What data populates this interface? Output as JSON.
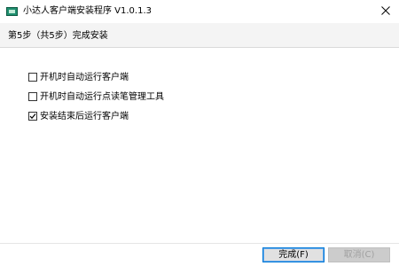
{
  "window": {
    "title": "小达人客户端安装程序 V1.0.1.3"
  },
  "step": {
    "title": "第5步（共5步）完成安装"
  },
  "options": [
    {
      "label": "开机时自动运行客户端",
      "checked": false
    },
    {
      "label": "开机时自动运行点读笔管理工具",
      "checked": false
    },
    {
      "label": "安装结束后运行客户端",
      "checked": true
    }
  ],
  "buttons": {
    "finish_label": "完成(F)",
    "cancel_label": "取消(C)"
  },
  "colors": {
    "focus_border": "#0078d7",
    "header_bg": "#f4f4f4",
    "disabled_button_bg": "#cccccc"
  }
}
